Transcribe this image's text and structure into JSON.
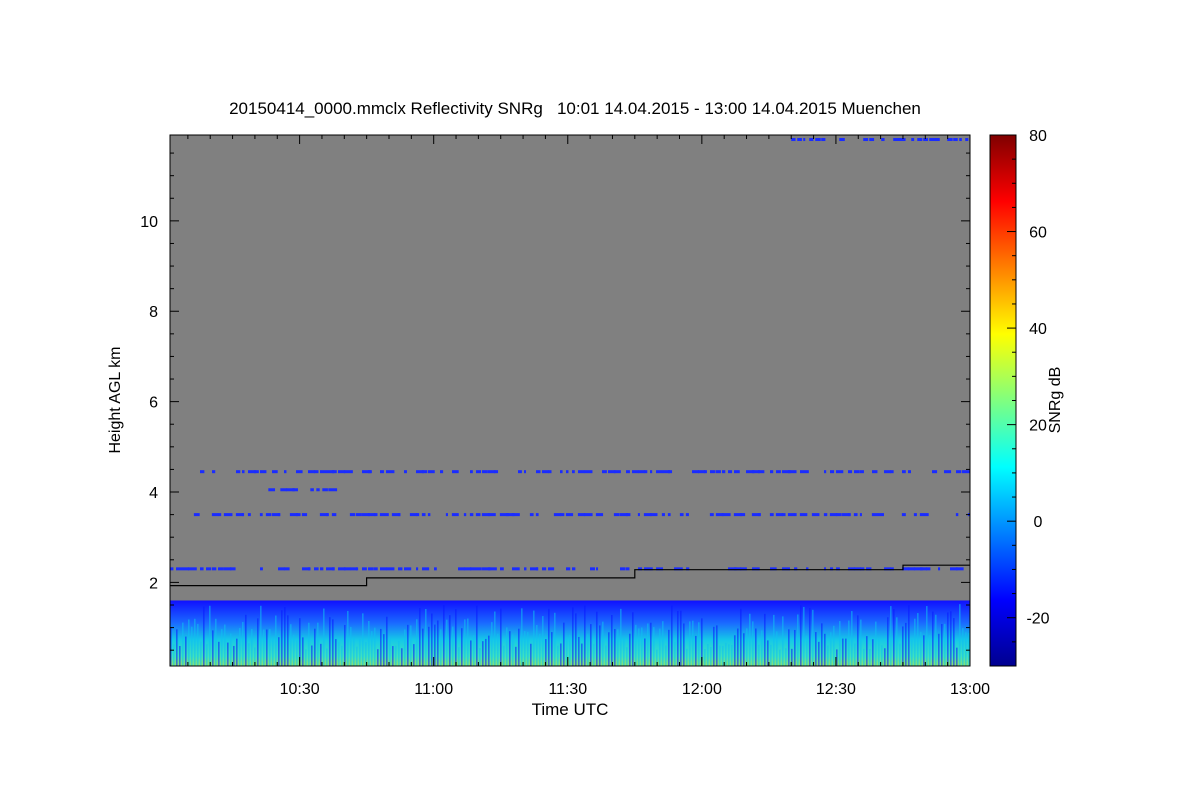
{
  "chart_data": {
    "type": "heatmap",
    "title": "20150414_0000.mmclx Reflectivity SNRg   10:01 14.04.2015 - 13:00 14.04.2015 Muenchen",
    "xlabel": "Time UTC",
    "ylabel": "Height AGL km",
    "colorbar_label": "SNRg dB",
    "xlim": [
      "10:01",
      "13:00"
    ],
    "x_ticks": [
      "10:30",
      "11:00",
      "11:30",
      "12:00",
      "12:30",
      "13:00"
    ],
    "ylim": [
      0.15,
      11.9
    ],
    "y_ticks": [
      2,
      4,
      6,
      8,
      10
    ],
    "colorbar_range": [
      -30,
      80
    ],
    "colorbar_ticks": [
      -20,
      0,
      20,
      40,
      60,
      80
    ],
    "colormap": "jet",
    "background_color": "#808080",
    "boundary_layer_line": {
      "color": "#000000",
      "time": [
        "10:01",
        "10:45",
        "10:45",
        "11:45",
        "11:45",
        "12:45",
        "12:45",
        "13:00"
      ],
      "height_km": [
        1.93,
        1.93,
        2.1,
        2.1,
        2.28,
        2.28,
        2.38,
        2.38
      ]
    },
    "echo_layers": [
      {
        "description": "near-surface echo",
        "time_start": "10:01",
        "time_end": "13:00",
        "height_bottom_km": 0.15,
        "height_top_km": 1.6,
        "snr_db_range": [
          -25,
          25
        ]
      },
      {
        "height_km": 4.45,
        "time_start": "10:01",
        "time_end": "13:00",
        "snr_db": -20
      },
      {
        "height_km": 4.05,
        "time_start": "10:23",
        "time_end": "10:37",
        "snr_db": -17
      },
      {
        "height_km": 3.5,
        "time_start": "10:05",
        "time_end": "13:00",
        "snr_db": -22
      },
      {
        "height_km": 2.3,
        "time_start": "10:01",
        "time_end": "13:00",
        "snr_db": -18
      },
      {
        "height_km": 11.8,
        "time_start": "12:20",
        "time_end": "13:00",
        "snr_db": -22
      }
    ]
  }
}
